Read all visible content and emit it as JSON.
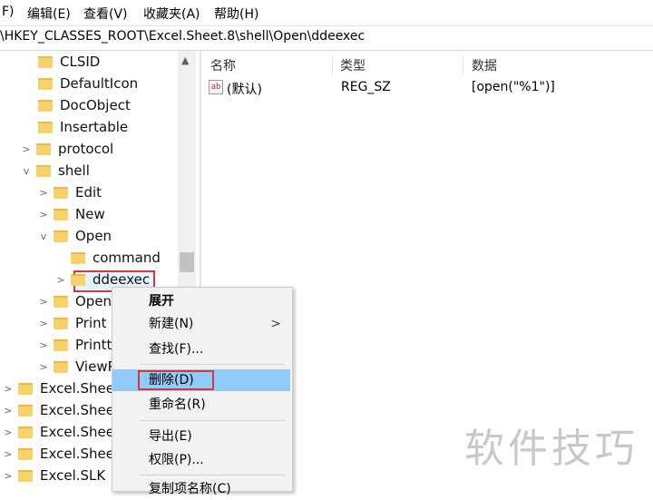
{
  "menubar": {
    "items": [
      "F)",
      "编辑(E)",
      "查看(V)",
      "收藏夹(A)",
      "帮助(H)"
    ]
  },
  "address": {
    "path": "\\HKEY_CLASSES_ROOT\\Excel.Sheet.8\\shell\\Open\\ddeexec"
  },
  "tree": {
    "items": [
      {
        "label": "CLSID",
        "chevron": ""
      },
      {
        "label": "DefaultIcon",
        "chevron": ""
      },
      {
        "label": "DocObject",
        "chevron": ""
      },
      {
        "label": "Insertable",
        "chevron": ""
      },
      {
        "label": "protocol",
        "chevron": ">"
      },
      {
        "label": "shell",
        "chevron": "v"
      },
      {
        "label": "Edit",
        "chevron": ">"
      },
      {
        "label": "New",
        "chevron": ">"
      },
      {
        "label": "Open",
        "chevron": "v"
      },
      {
        "label": "command",
        "chevron": ""
      },
      {
        "label": "ddeexec",
        "chevron": ">"
      },
      {
        "label": "OpenA",
        "chevron": ">"
      },
      {
        "label": "Print",
        "chevron": ">"
      },
      {
        "label": "Printto",
        "chevron": ">"
      },
      {
        "label": "ViewP",
        "chevron": ">"
      },
      {
        "label": "Excel.SheetI",
        "chevron": ">"
      },
      {
        "label": "Excel.SheetI",
        "chevron": ">"
      },
      {
        "label": "Excel.SheetI",
        "chevron": ">"
      },
      {
        "label": "Excel.SheetI",
        "chevron": ">"
      },
      {
        "label": "Excel.SLK",
        "chevron": ">"
      }
    ]
  },
  "list": {
    "headers": {
      "name": "名称",
      "type": "类型",
      "data": "数据"
    },
    "rows": [
      {
        "icon": "ab",
        "name": "(默认)",
        "type": "REG_SZ",
        "data": "[open(\"%1\")]"
      }
    ]
  },
  "context_menu": {
    "expand": "展开",
    "new": "新建(N)",
    "new_arrow": ">",
    "find": "查找(F)...",
    "delete": "删除(D)",
    "rename": "重命名(R)",
    "export": "导出(E)",
    "permissions": "权限(P)...",
    "copy_key": "复制项名称(C)"
  },
  "watermark": "软件技巧",
  "colors": {
    "highlight": "#91c9f7",
    "annotation_red": "#d03a3a",
    "folder": "#f6d36a"
  }
}
